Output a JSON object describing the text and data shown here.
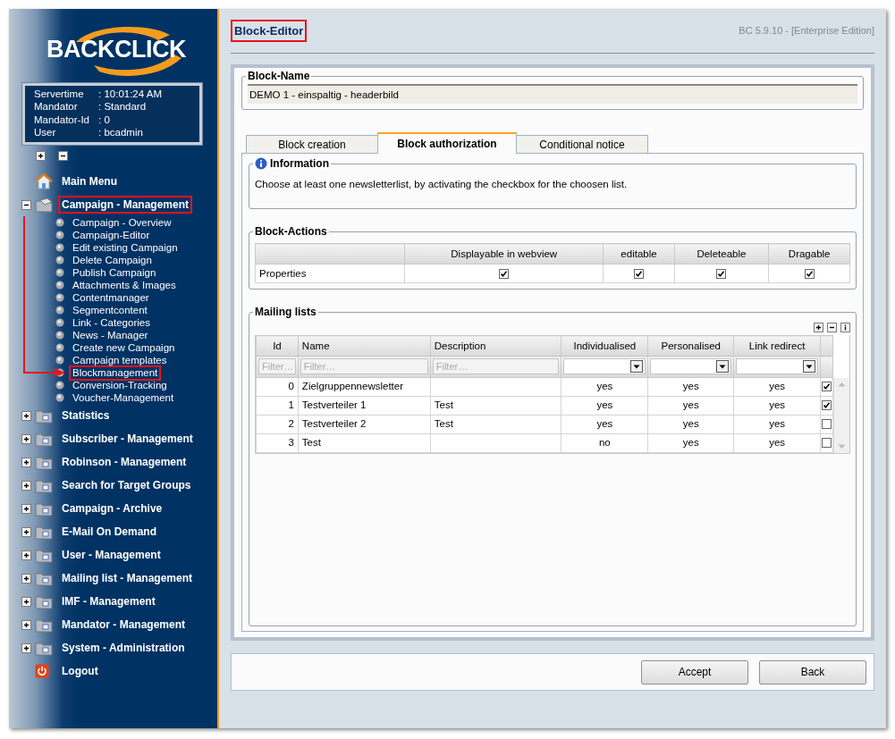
{
  "sidebar": {
    "logo": "BACKCLICK",
    "info": [
      {
        "label": "Servertime",
        "value": ": 10:01:24 AM"
      },
      {
        "label": "Mandator",
        "value": ": Standard"
      },
      {
        "label": "Mandator-Id",
        "value": ": 0"
      },
      {
        "label": "User",
        "value": ": bcadmin"
      }
    ],
    "menu": [
      {
        "label": "Main Menu",
        "kind": "home"
      },
      {
        "label": "Campaign - Management",
        "kind": "folder-open",
        "expanded": true,
        "highlighted": true,
        "children": [
          {
            "label": "Campaign - Overview",
            "highlighted": false
          },
          {
            "label": "Campaign-Editor",
            "highlighted": false
          },
          {
            "label": "Edit existing Campaign",
            "highlighted": false
          },
          {
            "label": "Delete Campaign",
            "highlighted": false
          },
          {
            "label": "Publish Campaign",
            "highlighted": false
          },
          {
            "label": "Attachments & Images",
            "highlighted": false
          },
          {
            "label": "Contentmanager",
            "highlighted": false
          },
          {
            "label": "Segmentcontent",
            "highlighted": false
          },
          {
            "label": "Link - Categories",
            "highlighted": false
          },
          {
            "label": "News - Manager",
            "highlighted": false
          },
          {
            "label": "Create new Campaign",
            "highlighted": false
          },
          {
            "label": "Campaign templates",
            "highlighted": false
          },
          {
            "label": "Blockmanagement",
            "highlighted": true
          },
          {
            "label": "Conversion-Tracking",
            "highlighted": false
          },
          {
            "label": "Voucher-Management",
            "highlighted": false
          }
        ]
      },
      {
        "label": "Statistics",
        "kind": "folder",
        "expanded": false,
        "highlighted": false
      },
      {
        "label": "Subscriber - Management",
        "kind": "folder",
        "expanded": false,
        "highlighted": false
      },
      {
        "label": "Robinson - Management",
        "kind": "folder",
        "expanded": false,
        "highlighted": false
      },
      {
        "label": "Search for Target Groups",
        "kind": "folder",
        "expanded": false,
        "highlighted": false
      },
      {
        "label": "Campaign - Archive",
        "kind": "folder",
        "expanded": false,
        "highlighted": false
      },
      {
        "label": "E-Mail On Demand",
        "kind": "folder",
        "expanded": false,
        "highlighted": false
      },
      {
        "label": "User - Management",
        "kind": "folder",
        "expanded": false,
        "highlighted": false
      },
      {
        "label": "Mailing list - Management",
        "kind": "folder",
        "expanded": false,
        "highlighted": false
      },
      {
        "label": "IMF - Management",
        "kind": "folder",
        "expanded": false,
        "highlighted": false
      },
      {
        "label": "Mandator - Management",
        "kind": "folder",
        "expanded": false,
        "highlighted": false
      },
      {
        "label": "System - Administration",
        "kind": "folder",
        "expanded": false,
        "highlighted": false
      },
      {
        "label": "Logout",
        "kind": "logout"
      }
    ]
  },
  "header": {
    "title": "Block-Editor",
    "highlighted": true,
    "version": "BC 5.9.10 - [Enterprise Edition]"
  },
  "block_name": {
    "legend": "Block-Name",
    "value": "DEMO 1 - einspaltig - headerbild"
  },
  "tabs": [
    {
      "label": "Block creation",
      "selected": false
    },
    {
      "label": "Block authorization",
      "selected": true
    },
    {
      "label": "Conditional notice",
      "selected": false
    }
  ],
  "information": {
    "legend": "Information",
    "text": "Choose at least one newsletterlist, by activating the checkbox for the choosen list."
  },
  "block_actions": {
    "legend": "Block-Actions",
    "columns": [
      "Displayable in webview",
      "editable",
      "Deleteable",
      "Dragable"
    ],
    "rows": [
      {
        "label": "Properties",
        "checks": [
          true,
          true,
          true,
          true
        ]
      }
    ]
  },
  "mailing_lists": {
    "legend": "Mailing lists",
    "columns": [
      "Id",
      "Name",
      "Description",
      "Individualised",
      "Personalised",
      "Link redirect"
    ],
    "filters": [
      {
        "kind": "text",
        "placeholder": "Filter…"
      },
      {
        "kind": "text",
        "placeholder": "Filter…"
      },
      {
        "kind": "text",
        "placeholder": "Filter…"
      },
      {
        "kind": "select"
      },
      {
        "kind": "select"
      },
      {
        "kind": "select"
      }
    ],
    "rows": [
      {
        "id": "0",
        "name": "Zielgruppennewsletter",
        "individualised": "yes",
        "personalised": "yes",
        "link_redirect": "yes",
        "checked": true
      },
      {
        "id": "1",
        "name": "Testverteiler 1",
        "description": "Test",
        "individualised": "yes",
        "personalised": "yes",
        "link_redirect": "yes",
        "checked": true
      },
      {
        "id": "2",
        "name": "Testverteiler 2",
        "description": "Test",
        "individualised": "yes",
        "personalised": "yes",
        "link_redirect": "yes",
        "checked": false
      },
      {
        "id": "3",
        "name": "Test",
        "individualised": "no",
        "personalised": "yes",
        "link_redirect": "yes",
        "checked": false
      }
    ]
  },
  "buttons": [
    "Accept",
    "Back"
  ]
}
